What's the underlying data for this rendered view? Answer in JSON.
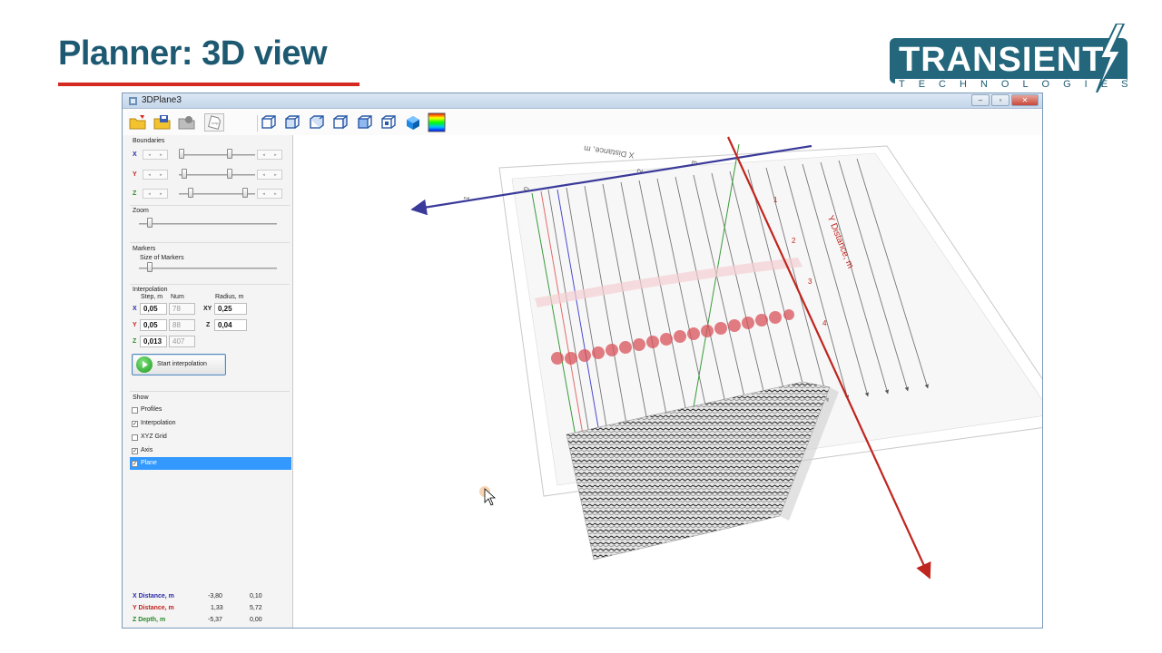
{
  "slide": {
    "title": "Planner: 3D view"
  },
  "logo": {
    "word": "TRANSIENT",
    "sub": "TECHNOLOGIES"
  },
  "window": {
    "title": "3DPlane3",
    "min": "–",
    "max": "▫",
    "close": "✕"
  },
  "toolbar": {
    "icons": [
      "open-folder-icon",
      "save-icon",
      "export-icon",
      "map-icon",
      "cube-view-1-icon",
      "cube-view-2-icon",
      "cube-view-3-icon",
      "cube-view-4-icon",
      "cube-view-5-icon",
      "cube-view-6-icon",
      "solid-cube-icon",
      "palette-icon"
    ]
  },
  "boundaries": {
    "label": "Boundaries",
    "x_label": "X",
    "y_label": "Y",
    "z_label": "Z",
    "x_range": [
      0.03,
      0.67
    ],
    "y_range": [
      0.07,
      0.67
    ],
    "z_range": [
      0.16,
      0.87
    ]
  },
  "zoom": {
    "label": "Zoom",
    "level": 0.08
  },
  "markers": {
    "label": "Markers",
    "size_label": "Size of Markers",
    "size": 0.08
  },
  "interpolation": {
    "label": "Interpolation",
    "step_header": "Step, m",
    "num_header": "Num",
    "radius_header": "Radius, m",
    "x_label": "X",
    "y_label": "Y",
    "z_label": "Z",
    "x_step": "0,05",
    "x_num": "78",
    "y_step": "0,05",
    "y_num": "88",
    "z_step": "0,013",
    "z_num": "407",
    "xy_label": "XY",
    "xy_radius": "0,25",
    "rz_label": "Z",
    "z_radius": "0,04",
    "start_label": "Start interpolation"
  },
  "show": {
    "label": "Show",
    "items": [
      {
        "label": "Profiles",
        "checked": false,
        "mark": ""
      },
      {
        "label": "Interpolation",
        "checked": true,
        "mark": "✓"
      },
      {
        "label": "XYZ Grid",
        "checked": false,
        "mark": ""
      },
      {
        "label": "Axis",
        "checked": true,
        "mark": "✓"
      },
      {
        "label": "Plane",
        "checked": true,
        "mark": "✓"
      }
    ]
  },
  "coords": {
    "x": {
      "label": "X Distance, m",
      "min": "-3,80",
      "max": "0,10"
    },
    "y": {
      "label": "Y Distance, m",
      "min": "1,33",
      "max": "5,72"
    },
    "z": {
      "label": "Z Depth, m",
      "min": "-5,37",
      "max": "0,00"
    }
  },
  "scene": {
    "x_axis_label": "X Distance, m",
    "y_axis_label": "Y Distance, m",
    "x_ticks": [
      "0",
      "1",
      "2",
      "3"
    ],
    "y_ticks": [
      "1",
      "2",
      "3",
      "4"
    ],
    "colors": {
      "x_axis": "#3a3a9a",
      "y_axis": "#c0241e",
      "z_axis": "#2a8a2a",
      "anomaly": "#d9535a"
    }
  }
}
